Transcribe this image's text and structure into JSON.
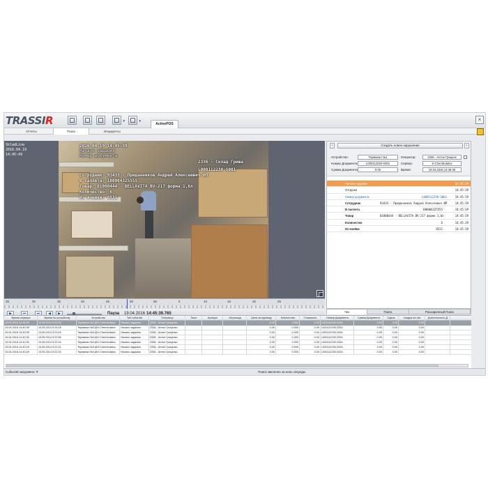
{
  "app": {
    "logo_main": "TRASSI",
    "logo_r": "R",
    "active_tab": "ActivePOS",
    "close_symbol": "×"
  },
  "module_tabs": [
    "Отчеты",
    "Поиск",
    "Инциденты"
  ],
  "camera": {
    "overlay_left_1": "SkladLine",
    "overlay_left_2": "2016.04.19",
    "overlay_left_3": "14:45:49",
    "overlay_date": "2016.04.19 14:45:39",
    "overlay_start": "Начало задания",
    "overlay_doc_label": "Номер документа",
    "overlay_employee": "Сотрудник: 93433 - Приданников Андрей Алексеевич ИП",
    "overlay_pallet": "В паллета: 100004325555",
    "overlay_item": "Товар: 01000444 - BELLAVITA BV-217 форма 1,6л",
    "overlay_qty": "Количество: 6",
    "overlay_place": "Из ячейки: 8531",
    "overlay_terminal": "2336 - Склад Гриша",
    "overlay_docno": "L000112230-S001"
  },
  "timeline": {
    "ticks": [
      "25",
      "30",
      "35",
      "40",
      "45",
      "50",
      "55",
      "5",
      "10",
      "15",
      "20",
      "25"
    ],
    "state": "Пауза",
    "date": "19.04.2016",
    "time": "14:45:39.765"
  },
  "right_panel": {
    "create_button": "Создать новое нарушение",
    "fields": {
      "device_label": "Устройство:",
      "device_value": "Терминал №1",
      "operator_label": "Оператор:",
      "operator_value": "2336 - Антон Гриценк",
      "doc_label": "Номер Документа:",
      "doc_value": "L000112230-S001",
      "server_label": "Сервер:",
      "server_value": "S-Chernbulatov",
      "sum_label": "Сумма Документа:",
      "sum_value": "0.00",
      "time_label": "Время:",
      "time_value": "19.04.2016 14:45:39"
    },
    "events": [
      {
        "name": "Начало задания",
        "value": "",
        "time": "14:45:39",
        "selected": true
      },
      {
        "name": "Отгрузка",
        "value": "",
        "time": "14:45:39"
      },
      {
        "name": "Номер документа",
        "value": "L000112230-S001",
        "time": "14:45:39",
        "blue": true
      },
      {
        "name": "Сотрудник",
        "value": "93433 - Приданников Андрей Алексеевич ИП",
        "time": "14:45:39"
      },
      {
        "name": "В паллета",
        "value": "100004325555",
        "time": "14:45:39",
        "rightval": true
      },
      {
        "name": "Товар",
        "value": "01000444 - BELLAVITA BV-217 форма 1,6л",
        "time": "14:45:39"
      },
      {
        "name": "Количество",
        "value": "6",
        "time": "14:45:39",
        "rightval": true
      },
      {
        "name": "Из ячейки",
        "value": "8531",
        "time": "14:45:39",
        "rightval": true
      }
    ],
    "tabs": [
      "Чек",
      "Поиск",
      "Расширенный Поиск"
    ]
  },
  "table": {
    "columns": [
      "Время сервера",
      "Время по устройству",
      "Устройство",
      "Тип события",
      "Оператор",
      "Текст",
      "Артикул",
      "Штрихкод",
      "Цена за единицу",
      "Количество",
      "Стоимость",
      "Номер Документа",
      "Сумма Документа",
      "Сдача",
      "Скидка на чек",
      "Длительность Д"
    ],
    "rows": [
      [
        "19.04.2016 14:45:39",
        "13.05.2014 9:22:04",
        "Терминал №1@V-Chernbulatov",
        "Начало задания",
        "2336 - Антон Гриценко",
        "",
        "",
        "",
        "0.00",
        "0.000",
        "0.00",
        "L000112230-S001",
        "0.00",
        "0.00",
        "0.00",
        ""
      ],
      [
        "19.04.2016 14:40:35",
        "13.05.2014 9:25:18",
        "Терминал №1@V-Chernbulatov",
        "Начало задания",
        "2336 - Антон Гриценко",
        "",
        "",
        "",
        "0.00",
        "0.000",
        "0.00",
        "L000112230-S001",
        "0.00",
        "0.00",
        "0.00",
        ""
      ],
      [
        "19.04.2016 14:40:39",
        "13.05.2014 9:23:03",
        "Терминал №1@V-Chernbulatov",
        "Начало задания",
        "2336 - Антон Гриценко",
        "",
        "",
        "",
        "0.00",
        "0.000",
        "0.00",
        "L000112230-S001",
        "0.00",
        "0.00",
        "0.00",
        ""
      ],
      [
        "19.04.2016 14:40:32",
        "13.05.2014 9:22:56",
        "Терминал №1@V-Chernbulatov",
        "Начало задания",
        "2336 - Антон Гриценко",
        "",
        "",
        "",
        "0.00",
        "0.000",
        "0.00",
        "L000112230-S001",
        "0.00",
        "0.00",
        "0.00",
        ""
      ],
      [
        "19.04.2016 14:40:32",
        "13.05.2014 9:22:44",
        "Терминал №1@V-Chernbulatov",
        "Начало задания",
        "2336 - Антон Гриценко",
        "",
        "",
        "",
        "0.00",
        "0.000",
        "0.00",
        "L000112230-S001",
        "0.00",
        "0.00",
        "0.00",
        ""
      ],
      [
        "19.04.2016 14:40:29",
        "13.05.2014 9:22:31",
        "Терминал №1@V-Chernbulatov",
        "Начало задания",
        "2336 - Антон Гриценко",
        "",
        "",
        "",
        "0.00",
        "0.000",
        "0.00",
        "L000112230-S001",
        "0.00",
        "0.00",
        "0.00",
        ""
      ],
      [
        "19.04.2016 14:40:29",
        "13.05.2014 9:22:23",
        "Терминал №1@V-Chernbulatov",
        "Начало задания",
        "2336 - Антон Гриценко",
        "",
        "",
        "",
        "0.00",
        "0.000",
        "0.00",
        "L000112230-S001",
        "0.00",
        "0.00",
        "0.00",
        ""
      ]
    ]
  },
  "status": {
    "loaded_label": "Событий загружено:",
    "loaded_count": "7",
    "message": "Поиск закончен за ноль секунды"
  },
  "colors": {
    "accent_selected": "#f39b4c",
    "link_blue": "#2a5ec4",
    "logo_red": "#d9251d"
  }
}
